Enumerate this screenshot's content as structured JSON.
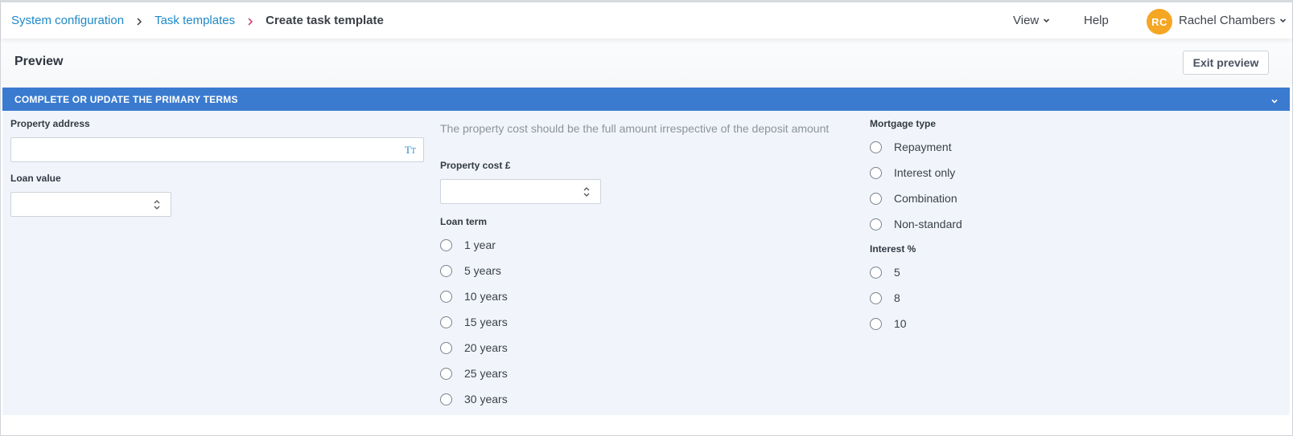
{
  "breadcrumb": {
    "items": [
      {
        "label": "System configuration"
      },
      {
        "label": "Task templates"
      }
    ],
    "current": "Create task template"
  },
  "header": {
    "view_label": "View",
    "help_label": "Help",
    "user": {
      "initials": "RC",
      "name": "Rachel Chambers"
    }
  },
  "colors": {
    "accent": "#3a7bcf",
    "link": "#1e88c8",
    "avatar": "#f5a623",
    "section_bg": "#f1f5fb"
  },
  "preview": {
    "title": "Preview",
    "exit_label": "Exit preview"
  },
  "section": {
    "title": "COMPLETE OR UPDATE THE PRIMARY TERMS"
  },
  "form": {
    "property_address": {
      "label": "Property address",
      "value": ""
    },
    "loan_value": {
      "label": "Loan value",
      "value": ""
    },
    "property_cost_hint": "The property cost should be the full amount irrespective of the deposit amount",
    "property_cost": {
      "label": "Property cost £",
      "value": ""
    },
    "loan_term": {
      "label": "Loan term",
      "options": [
        "1 year",
        "5 years",
        "10 years",
        "15 years",
        "20 years",
        "25 years",
        "30 years"
      ]
    },
    "mortgage_type": {
      "label": "Mortgage type",
      "options": [
        "Repayment",
        "Interest only",
        "Combination",
        "Non-standard"
      ]
    },
    "interest": {
      "label": "Interest %",
      "options": [
        "5",
        "8",
        "10"
      ]
    }
  }
}
